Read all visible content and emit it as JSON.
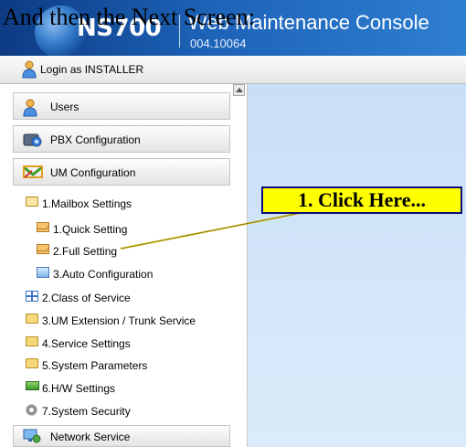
{
  "overlay_caption": "And then the Next Screen:",
  "header": {
    "product": "NS700",
    "title": "Web Maintenance Console",
    "version": "004.10064"
  },
  "login": {
    "label": "Login as INSTALLER",
    "icon": "user-icon"
  },
  "sections": {
    "users": "Users",
    "pbx": "PBX Configuration",
    "um": "UM Configuration",
    "network": "Network Service"
  },
  "tree": {
    "mailbox_settings": "1.Mailbox Settings",
    "quick_setting": "1.Quick Setting",
    "full_setting": "2.Full Setting",
    "auto_config": "3.Auto Configuration",
    "class_of_service": "2.Class of Service",
    "um_extension": "3.UM Extension / Trunk Service",
    "service_settings": "4.Service Settings",
    "system_parameters": "5.System Parameters",
    "hw_settings": "6.H/W Settings",
    "system_security": "7.System Security"
  },
  "callout": {
    "label": "1. Click Here..."
  },
  "colors": {
    "header_dark": "#0d3b83",
    "header_light": "#2f7fd1",
    "main_bg": "#d0e4f9",
    "callout_bg": "#ffff00"
  }
}
